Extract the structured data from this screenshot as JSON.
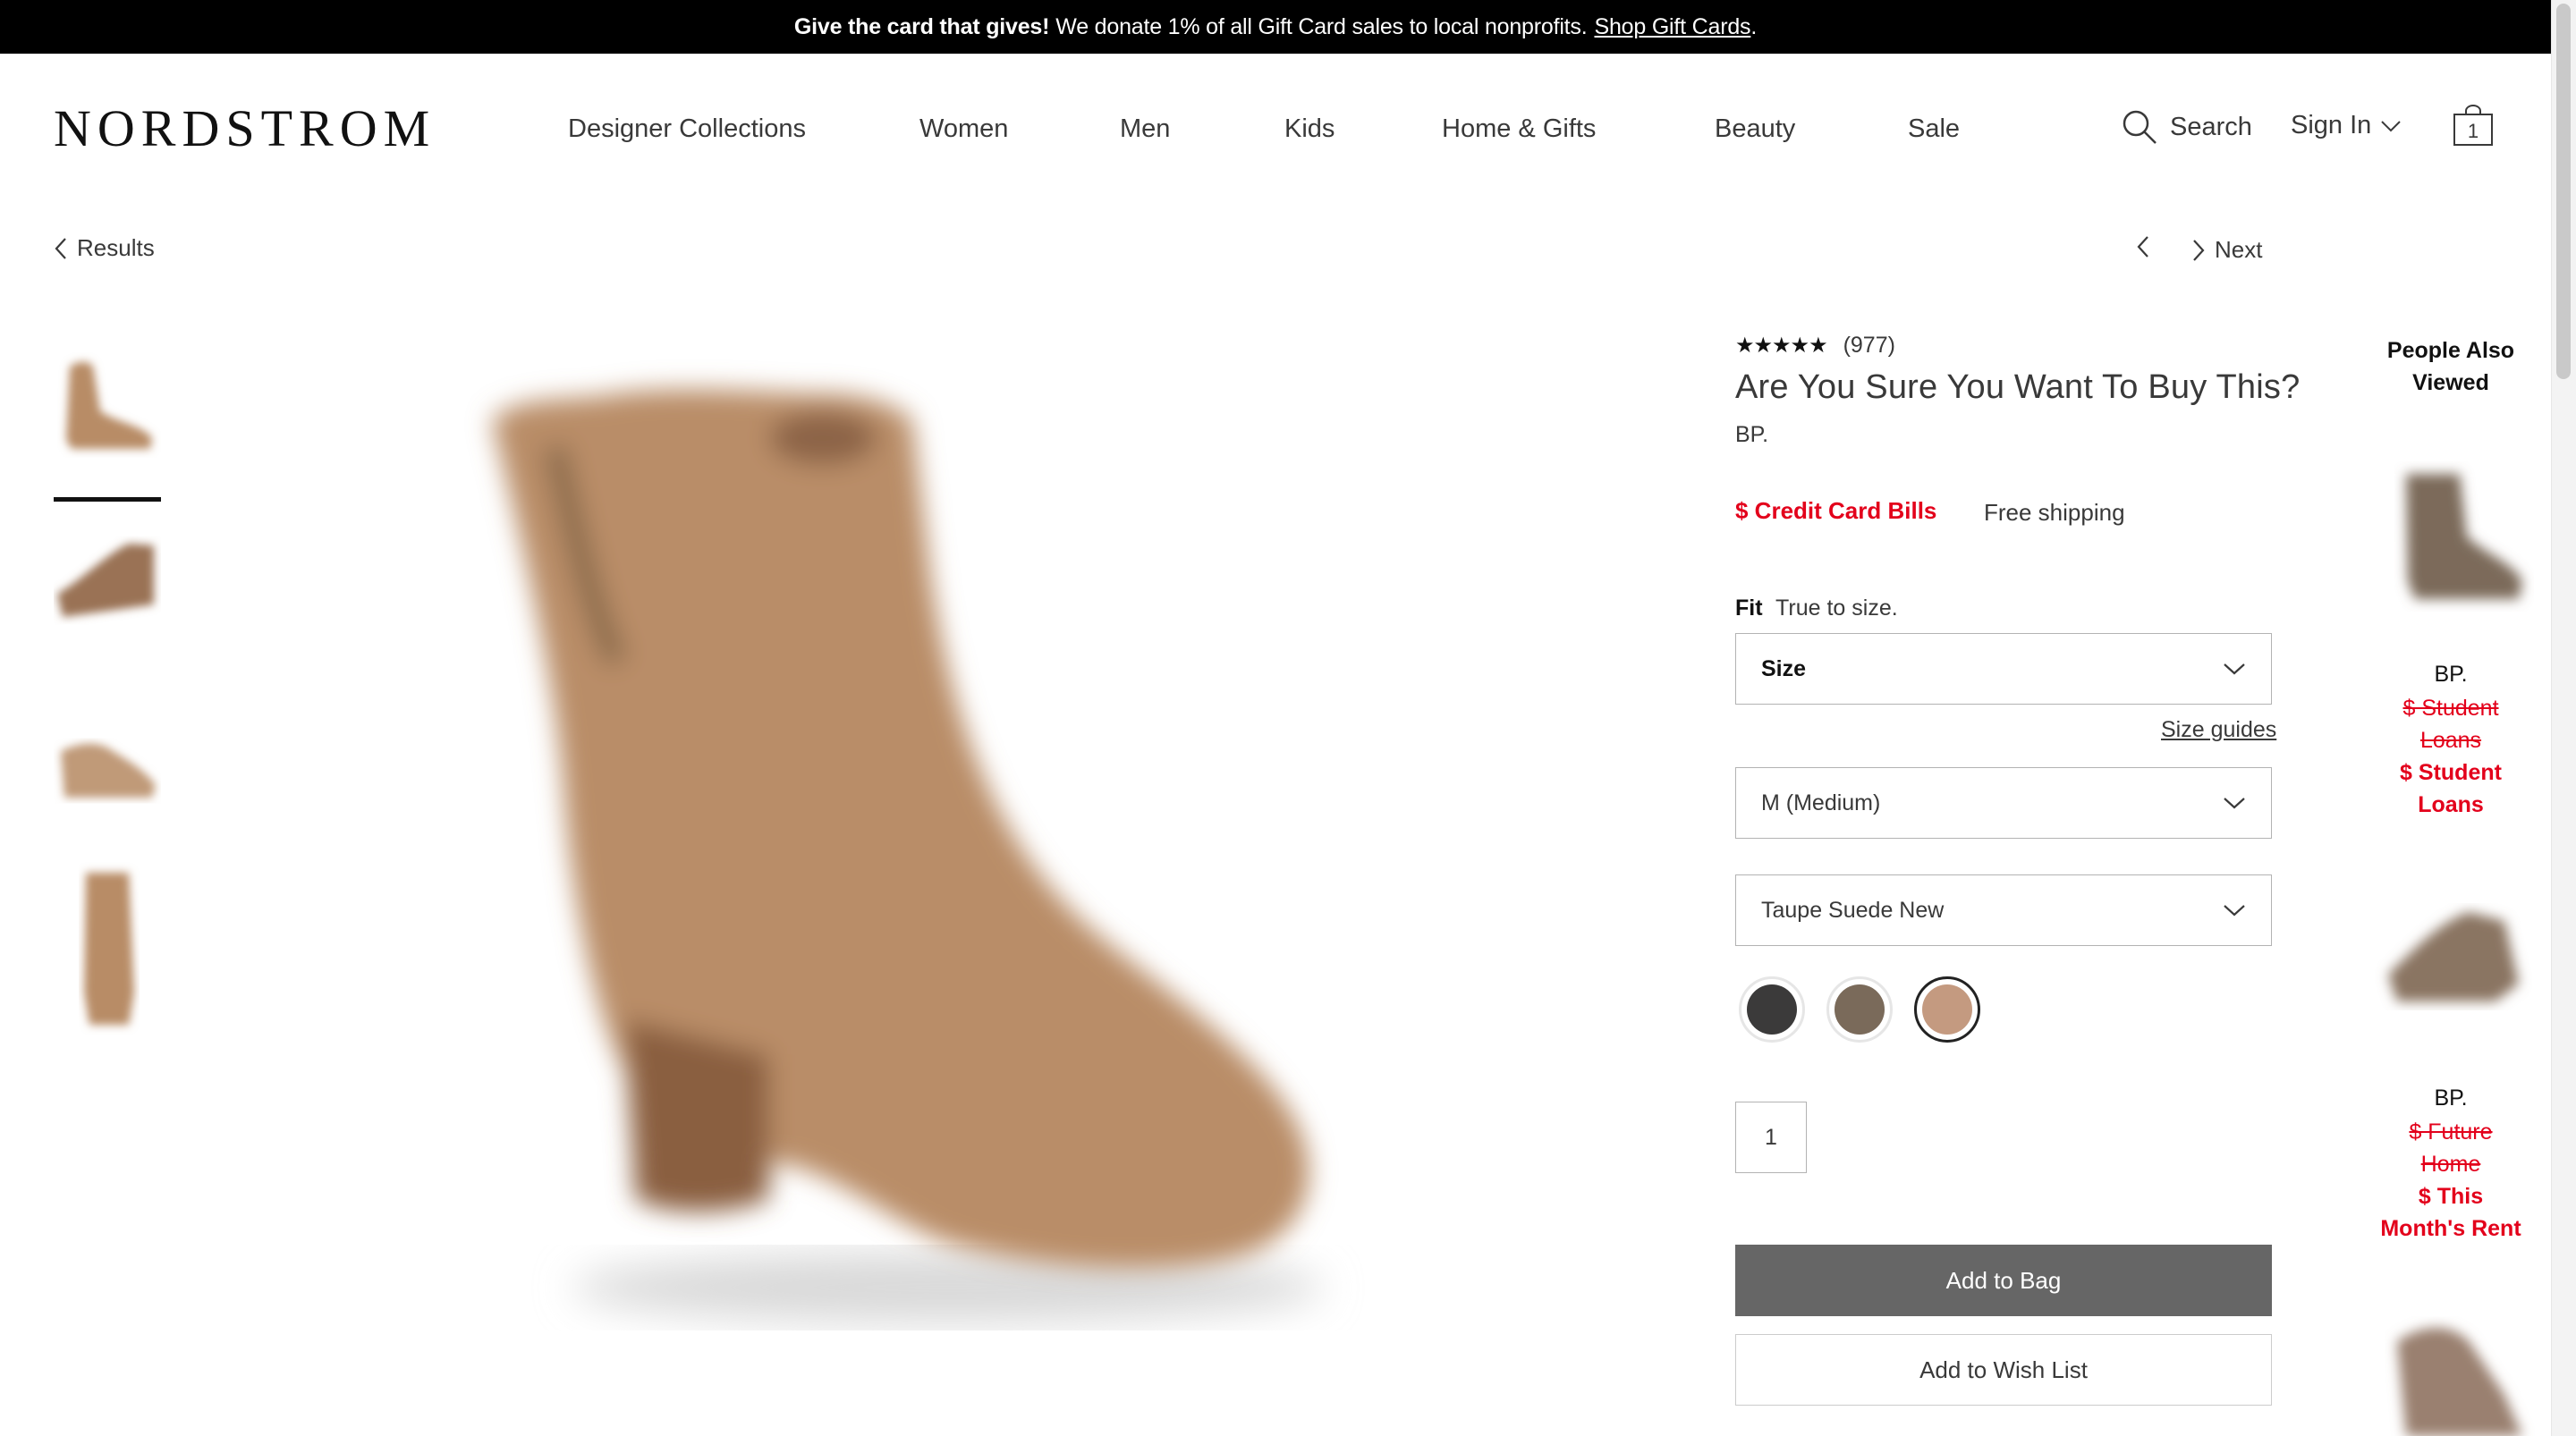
{
  "banner": {
    "bold": "Give the card that gives!",
    "text": "We donate 1% of all Gift Card sales to local nonprofits.",
    "link": "Shop Gift Cards",
    "period": "."
  },
  "header": {
    "logo": "NORDSTROM",
    "nav": [
      "Designer Collections",
      "Women",
      "Men",
      "Kids",
      "Home & Gifts",
      "Beauty",
      "Sale"
    ],
    "search_label": "Search",
    "signin_label": "Sign In",
    "bag_count": "1"
  },
  "breadcrumb": {
    "results": "Results",
    "next": "Next"
  },
  "product": {
    "rating": 4.5,
    "stars": "★★★★★",
    "reviews": "(977)",
    "title": "Are You Sure You Want To Buy This?",
    "brand": "BP.",
    "price": "$ Credit Card Bills",
    "shipping": "Free shipping",
    "fit_label": "Fit",
    "fit_value": "True to size.",
    "size_select": "Size",
    "size_guides": "Size guides",
    "width_select": "M (Medium)",
    "color_select": "Taupe Suede New",
    "swatches": [
      {
        "color": "#3b3a3a",
        "selected": false
      },
      {
        "color": "#7a6a5a",
        "selected": false
      },
      {
        "color": "#c49a80",
        "selected": true
      }
    ],
    "quantity": "1",
    "add_to_bag": "Add to Bag",
    "add_to_wishlist": "Add to Wish List"
  },
  "people_also_viewed": {
    "heading_line1": "People Also",
    "heading_line2": "Viewed",
    "items": [
      {
        "brand": "BP.",
        "old_line1": "$ Student",
        "old_line2": "Loans",
        "new_line1": "$ Student",
        "new_line2": "Loans"
      },
      {
        "brand": "BP.",
        "old_line1": "$ Future",
        "old_line2": "Home",
        "new_line1": "$ This",
        "new_line2": "Month's Rent"
      }
    ]
  },
  "colors": {
    "sale_red": "#e3001b",
    "button_gray": "#666666",
    "banner_black": "#000000",
    "boot_tan": "#b88c66"
  }
}
